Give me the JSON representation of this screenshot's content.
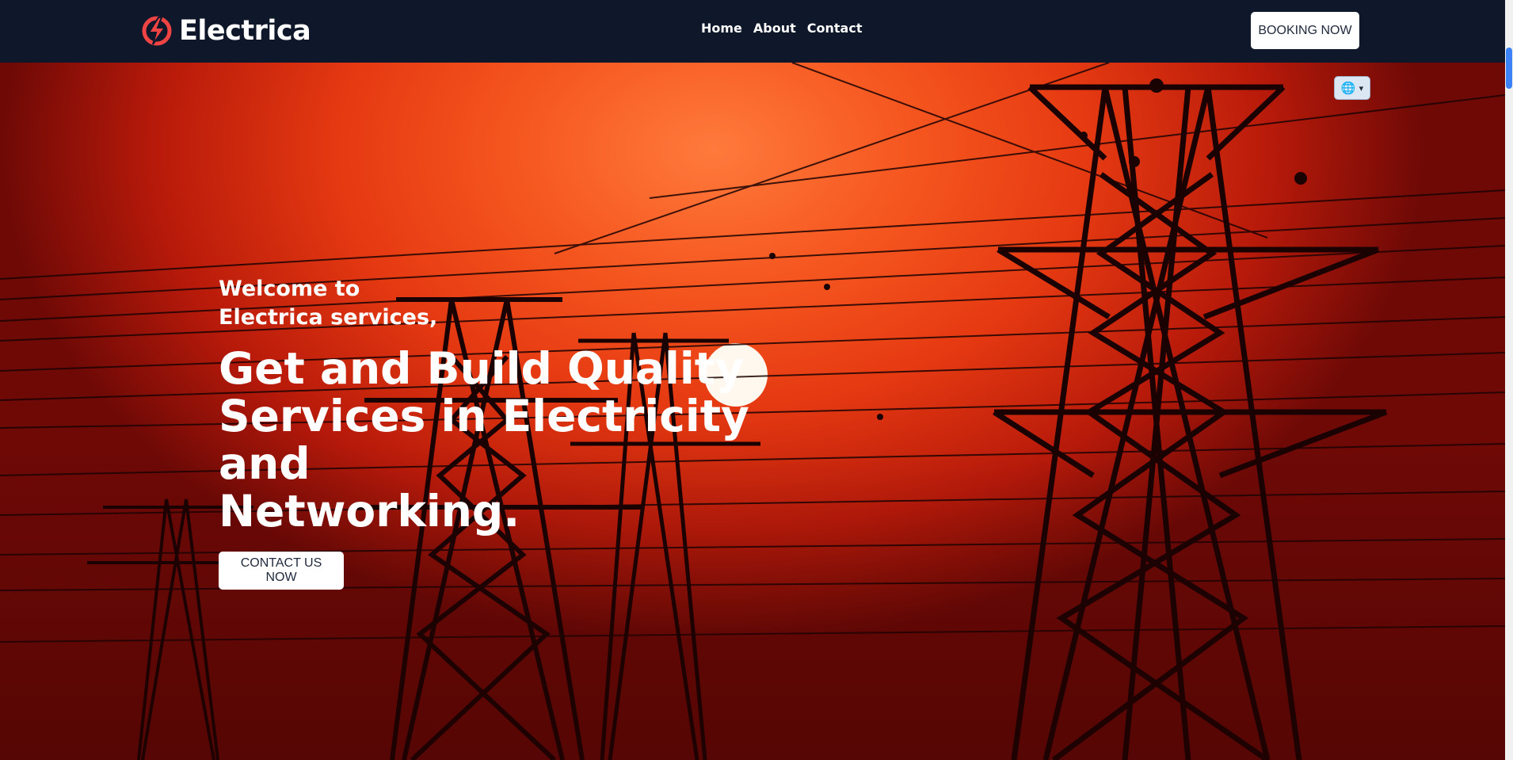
{
  "header": {
    "brand_name": "Electrica",
    "nav": [
      "Home",
      "About",
      "Contact"
    ],
    "booking_label": "BOOKING NOW"
  },
  "hero": {
    "welcome_line1": "Welcome to",
    "welcome_line2": "Electrica services,",
    "headline_line1": "Get and Build Quality",
    "headline_line2": "Services in Electricity and",
    "headline_line3": "Networking.",
    "contact_label": "CONTACT US NOW"
  },
  "language_selector": {
    "icon": "globe-icon"
  },
  "colors": {
    "navbar": "#0f172a",
    "brand_icon": "#ef4444",
    "button_bg": "#ffffff",
    "hero_sky": "#f5561f"
  }
}
